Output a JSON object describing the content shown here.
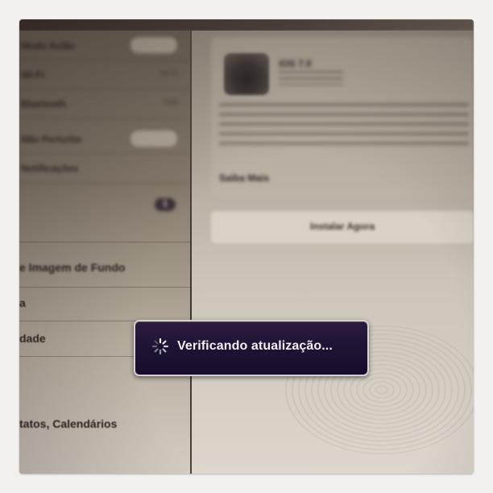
{
  "left_column": {
    "top_rows": [
      {
        "label": "Modo Avião",
        "value": ""
      },
      {
        "label": "Wi-Fi",
        "value": "Wi-Fi"
      },
      {
        "label": "Bluetooth",
        "value": "Não"
      },
      {
        "label": "Não Perturbe",
        "value": ""
      },
      {
        "label": "Notificações",
        "value": ""
      }
    ],
    "badge_count": "1",
    "items": [
      {
        "label": "e Imagem de Fundo"
      },
      {
        "label": "a"
      },
      {
        "label": "dade"
      },
      {
        "label": "tatos, Calendários"
      }
    ]
  },
  "update_panel": {
    "title": "iOS 7.0",
    "more_link": "Saiba Mais",
    "install_button": "Instalar Agora"
  },
  "hud": {
    "message": "Verificando atualização..."
  }
}
